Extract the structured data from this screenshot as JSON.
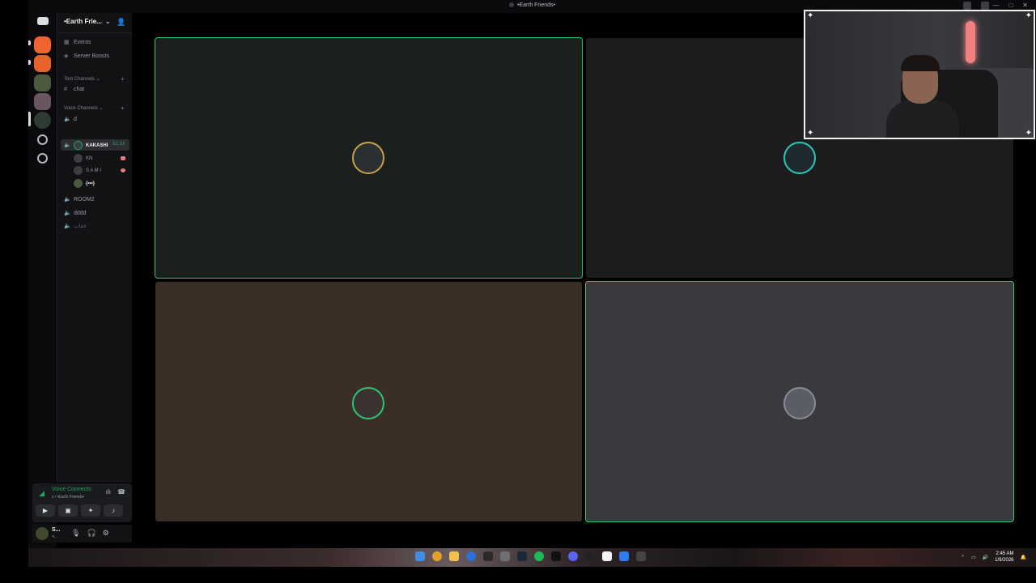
{
  "window": {
    "title": "•Earth Friends•"
  },
  "server": {
    "name": "•Earth Frie...",
    "chevron": "⌄"
  },
  "sidebar": {
    "top_items": [
      {
        "icon": "calendar-icon",
        "label": "Events"
      },
      {
        "icon": "boost-icon",
        "label": "Server Boosts"
      }
    ],
    "text_category": "Text Channels",
    "text_channels": [
      {
        "label": "chat"
      }
    ],
    "voice_category": "Voice Channels",
    "voice_channels": [
      {
        "label": "d"
      },
      {
        "label": "s",
        "timer": "51:13"
      },
      {
        "label": "ROOM2"
      },
      {
        "label": "dddd"
      },
      {
        "label": "عقاب"
      }
    ],
    "voice_users": [
      {
        "name": "KAKASHI",
        "speaking": true
      },
      {
        "name": "KN"
      },
      {
        "name": "S A M I"
      },
      {
        "name": "{•••}"
      }
    ]
  },
  "voice_panel": {
    "status": "Voice Connects",
    "channel": "s / •Earth Friends•"
  },
  "user_bar": {
    "name": "S...",
    "status": "•i..."
  },
  "taskbar": {
    "time": "2:45 AM",
    "date": "1/9/2026"
  },
  "colors": {
    "accent_green": "#2dc770",
    "bg_dark": "#121214",
    "tile1": "#1b1f1e",
    "tile2": "#1c1c1e",
    "tile3": "#3a2f27",
    "tile4": "#3a393d"
  }
}
